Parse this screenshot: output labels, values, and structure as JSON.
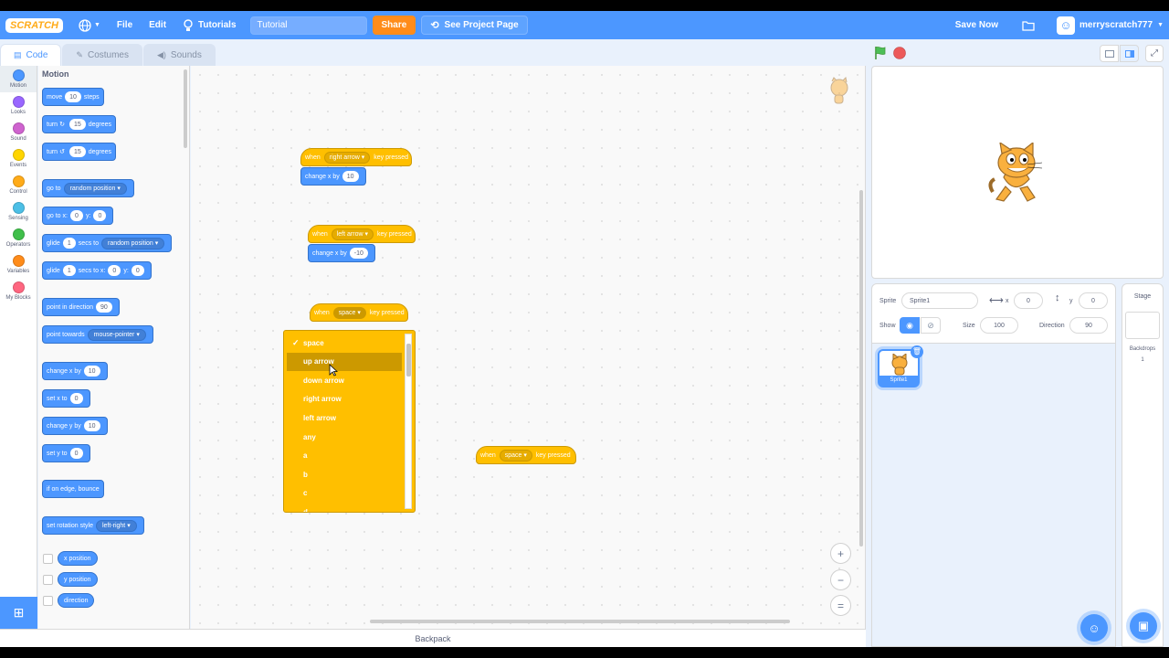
{
  "menubar": {
    "logo": "SCRATCH",
    "file": "File",
    "edit": "Edit",
    "tutorials": "Tutorials",
    "project_title": "Tutorial",
    "share": "Share",
    "see_project_page": "See Project Page",
    "save_now": "Save Now",
    "username": "merryscratch777"
  },
  "tabs": {
    "code": "Code",
    "costumes": "Costumes",
    "sounds": "Sounds"
  },
  "categories": [
    {
      "label": "Motion",
      "color": "#4c97ff"
    },
    {
      "label": "Looks",
      "color": "#9966ff"
    },
    {
      "label": "Sound",
      "color": "#cf63cf"
    },
    {
      "label": "Events",
      "color": "#ffd500"
    },
    {
      "label": "Control",
      "color": "#ffab19"
    },
    {
      "label": "Sensing",
      "color": "#4cbfe6"
    },
    {
      "label": "Operators",
      "color": "#40bf4a"
    },
    {
      "label": "Variables",
      "color": "#ff8c1a"
    },
    {
      "label": "My Blocks",
      "color": "#ff6680"
    }
  ],
  "palette": {
    "heading": "Motion",
    "move": {
      "a": "move",
      "v": "10",
      "b": "steps"
    },
    "turn_right": {
      "a": "turn",
      "v": "15",
      "b": "degrees"
    },
    "turn_left": {
      "a": "turn",
      "v": "15",
      "b": "degrees"
    },
    "go_to": {
      "a": "go to",
      "v": "random position"
    },
    "go_to_xy": {
      "a": "go to x:",
      "x": "0",
      "y_lbl": "y:",
      "y": "0"
    },
    "glide_to": {
      "a": "glide",
      "v": "1",
      "b": "secs to",
      "t": "random position"
    },
    "glide_xy": {
      "a": "glide",
      "v": "1",
      "b": "secs to x:",
      "x": "0",
      "y_lbl": "y:",
      "y": "0"
    },
    "point_dir": {
      "a": "point in direction",
      "v": "90"
    },
    "point_towards": {
      "a": "point towards",
      "v": "mouse-pointer"
    },
    "change_x": {
      "a": "change x by",
      "v": "10"
    },
    "set_x": {
      "a": "set x to",
      "v": "0"
    },
    "change_y": {
      "a": "change y by",
      "v": "10"
    },
    "set_y": {
      "a": "set y to",
      "v": "0"
    },
    "bounce": "if on edge, bounce",
    "rotation": {
      "a": "set rotation style",
      "v": "left-right"
    },
    "x_pos": "x position",
    "y_pos": "y position",
    "direction": "direction"
  },
  "scripts": {
    "s1": {
      "when": "when",
      "key": "right arrow",
      "pressed": "key pressed",
      "action": "change x by",
      "value": "10"
    },
    "s2": {
      "when": "when",
      "key": "left arrow",
      "pressed": "key pressed",
      "action": "change x by",
      "value": "-10"
    },
    "s3": {
      "when": "when",
      "key": "space",
      "pressed": "key pressed"
    },
    "s4": {
      "when": "when",
      "key": "space",
      "pressed": "key pressed"
    }
  },
  "dropdown": {
    "items": [
      "space",
      "up arrow",
      "down arrow",
      "right arrow",
      "left arrow",
      "any",
      "a",
      "b",
      "c",
      "d"
    ],
    "selected": "space",
    "hovered": "up arrow"
  },
  "zoom": {
    "in": "+",
    "out": "−",
    "reset": "="
  },
  "backpack": "Backpack",
  "sprite_info": {
    "sprite_label": "Sprite",
    "sprite_name": "Sprite1",
    "x_label": "x",
    "x": "0",
    "y_label": "y",
    "y": "0",
    "show_label": "Show",
    "size_label": "Size",
    "size": "100",
    "direction_label": "Direction",
    "direction": "90"
  },
  "sprite_list": [
    {
      "name": "Sprite1"
    }
  ],
  "stage_pane": {
    "label": "Stage",
    "backdrops_label": "Backdrops",
    "backdrops_count": "1"
  }
}
